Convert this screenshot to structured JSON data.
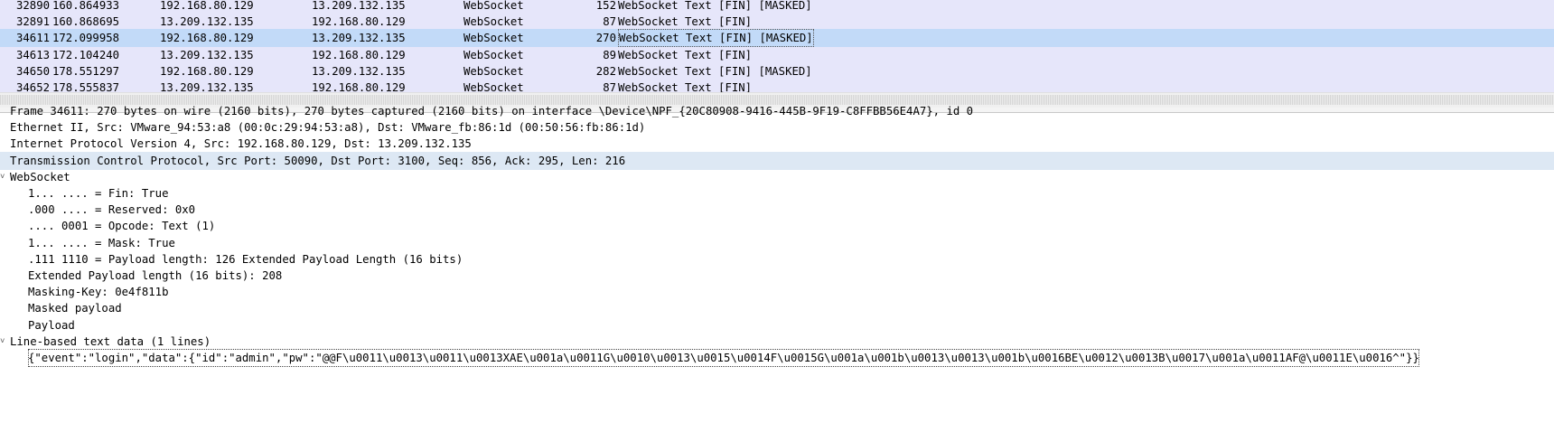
{
  "packet_list": {
    "rows": [
      {
        "no": "32890",
        "time": "160.864933",
        "src": "192.168.80.129",
        "dst": "13.209.132.135",
        "proto": "WebSocket",
        "len": "152",
        "info": "WebSocket Text [FIN] [MASKED]",
        "selected": false,
        "partial": "top"
      },
      {
        "no": "32891",
        "time": "160.868695",
        "src": "13.209.132.135",
        "dst": "192.168.80.129",
        "proto": "WebSocket",
        "len": "87",
        "info": "WebSocket Text [FIN]",
        "selected": false
      },
      {
        "no": "34611",
        "time": "172.099958",
        "src": "192.168.80.129",
        "dst": "13.209.132.135",
        "proto": "WebSocket",
        "len": "270",
        "info": "WebSocket Text [FIN] [MASKED]",
        "selected": true
      },
      {
        "no": "34613",
        "time": "172.104240",
        "src": "13.209.132.135",
        "dst": "192.168.80.129",
        "proto": "WebSocket",
        "len": "89",
        "info": "WebSocket Text [FIN]",
        "selected": false
      },
      {
        "no": "34650",
        "time": "178.551297",
        "src": "192.168.80.129",
        "dst": "13.209.132.135",
        "proto": "WebSocket",
        "len": "282",
        "info": "WebSocket Text [FIN] [MASKED]",
        "selected": false
      },
      {
        "no": "34652",
        "time": "178.555837",
        "src": "13.209.132.135",
        "dst": "192.168.80.129",
        "proto": "WebSocket",
        "len": "87",
        "info": "WebSocket Text [FIN]",
        "selected": false,
        "partial": "bottom"
      }
    ]
  },
  "details": {
    "rows": [
      {
        "level": 0,
        "text": "Frame 34611: 270 bytes on wire (2160 bits), 270 bytes captured (2160 bits) on interface \\Device\\NPF_{20C80908-9416-445B-9F19-C8FFBB56E4A7}, id 0",
        "highlight": false
      },
      {
        "level": 0,
        "text": "Ethernet II, Src: VMware_94:53:a8 (00:0c:29:94:53:a8), Dst: VMware_fb:86:1d (00:50:56:fb:86:1d)",
        "highlight": false
      },
      {
        "level": 0,
        "text": "Internet Protocol Version 4, Src: 192.168.80.129, Dst: 13.209.132.135",
        "highlight": false
      },
      {
        "level": 0,
        "text": "Transmission Control Protocol, Src Port: 50090, Dst Port: 3100, Seq: 856, Ack: 295, Len: 216",
        "highlight": true
      },
      {
        "level": 0,
        "text": "WebSocket",
        "highlight": false,
        "expanded": true
      },
      {
        "level": 1,
        "text": "1... .... = Fin: True",
        "highlight": false
      },
      {
        "level": 1,
        "text": ".000 .... = Reserved: 0x0",
        "highlight": false
      },
      {
        "level": 1,
        "text": ".... 0001 = Opcode: Text (1)",
        "highlight": false
      },
      {
        "level": 1,
        "text": "1... .... = Mask: True",
        "highlight": false
      },
      {
        "level": 1,
        "text": ".111 1110 = Payload length: 126 Extended Payload Length (16 bits)",
        "highlight": false
      },
      {
        "level": 1,
        "text": "Extended Payload length (16 bits): 208",
        "highlight": false
      },
      {
        "level": 1,
        "text": "Masking-Key: 0e4f811b",
        "highlight": false
      },
      {
        "level": 1,
        "text": "Masked payload",
        "highlight": false
      },
      {
        "level": 1,
        "text": "Payload",
        "highlight": false
      },
      {
        "level": 0,
        "text": "Line-based text data (1 lines)",
        "highlight": false,
        "expanded": true
      },
      {
        "level": 1,
        "text": "{\"event\":\"login\",\"data\":{\"id\":\"admin\",\"pw\":\"@@F\\u0011\\u0013\\u0011\\u0013XAE\\u001a\\u0011G\\u0010\\u0013\\u0015\\u0014F\\u0015G\\u001a\\u001b\\u0013\\u0013\\u001b\\u0016BE\\u0012\\u0013B\\u0017\\u001a\\u0011AF@\\u0011E\\u0016^\"}}",
        "highlight": false,
        "boxed": true
      }
    ]
  },
  "colors": {
    "list_bg": "#e6e6fa",
    "selected_bg": "#c2daf8",
    "detail_highlight": "#dde8f4"
  }
}
